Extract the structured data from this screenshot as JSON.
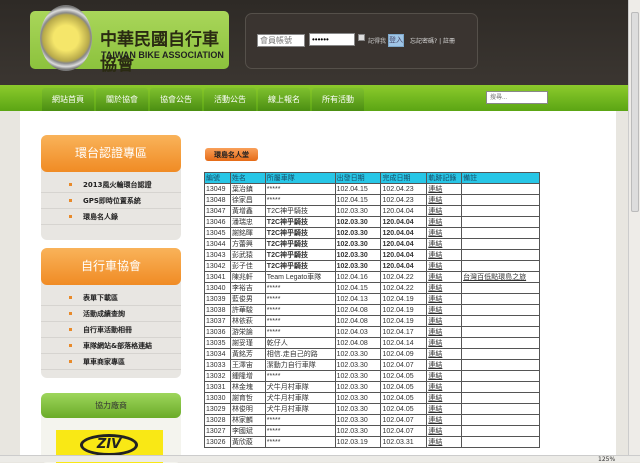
{
  "header": {
    "logo_cn": "中華民國自行車協會",
    "logo_en": "TAIWAN BIKE ASSOCIATION",
    "login": {
      "user_placeholder": "會員帳號",
      "password_value": "••••••",
      "remember_label": "記得我",
      "login_button": "登入",
      "forgot_link": "忘記密碼? | 註冊"
    }
  },
  "nav": {
    "items": [
      "網站首頁",
      "關於協會",
      "協會公告",
      "活動公告",
      "線上報名",
      "所有活動"
    ],
    "search_placeholder": "搜尋..."
  },
  "sidebar": {
    "box1": {
      "title": "環台認證專區",
      "items": [
        "2013風火輪環台認證",
        "GPS即時位置系統",
        "環島名人錄"
      ]
    },
    "box2": {
      "title": "自行車協會",
      "items": [
        "表單下載區",
        "活動成績查詢",
        "自行車活動相冊",
        "車隊網站&部落格連結",
        "單車商家專區"
      ]
    },
    "box3": {
      "title": "協力廠商",
      "sponsor": "ZIV"
    }
  },
  "main": {
    "banner": "環島名人堂",
    "columns": [
      "編號",
      "姓名",
      "所屬車隊",
      "出發日期",
      "完成日期",
      "軌跡記錄",
      "備註"
    ],
    "rows": [
      [
        "13049",
        "葉治鎮",
        "*****",
        "102.04.15",
        "102.04.23",
        "連結",
        ""
      ],
      [
        "13048",
        "徐家昌",
        "*****",
        "102.04.15",
        "102.04.23",
        "連結",
        ""
      ],
      [
        "13047",
        "黃增鑫",
        "T2C神乎騎技",
        "102.03.30",
        "120.04.04",
        "連結",
        ""
      ],
      [
        "13046",
        "潘瑞忠",
        "T2C神乎騎技",
        "102.03.30",
        "120.04.04",
        "連結",
        ""
      ],
      [
        "13045",
        "謝銘暉",
        "T2C神乎騎技",
        "102.03.30",
        "120.04.04",
        "連結",
        ""
      ],
      [
        "13044",
        "方蕾興",
        "T2C神乎騎技",
        "102.03.30",
        "120.04.04",
        "連結",
        ""
      ],
      [
        "13043",
        "彭武猿",
        "T2C神乎騎技",
        "102.03.30",
        "120.04.04",
        "連結",
        ""
      ],
      [
        "13042",
        "彭子佳",
        "T2C神乎騎技",
        "102.03.30",
        "120.04.04",
        "連結",
        ""
      ],
      [
        "13041",
        "陳兆軒",
        "Team Legato車隊",
        "102.04.16",
        "102.04.22",
        "連結",
        "台灣百低點環島之旅"
      ],
      [
        "13040",
        "李裕吉",
        "*****",
        "102.04.15",
        "102.04.22",
        "連結",
        ""
      ],
      [
        "13039",
        "藍俊男",
        "*****",
        "102.04.13",
        "102.04.19",
        "連結",
        ""
      ],
      [
        "13038",
        "許華駿",
        "*****",
        "102.04.08",
        "102.04.19",
        "連結",
        ""
      ],
      [
        "13037",
        "林依萩",
        "*****",
        "102.04.08",
        "102.04.19",
        "連結",
        ""
      ],
      [
        "13036",
        "游栄論",
        "*****",
        "102.04.03",
        "102.04.17",
        "連結",
        ""
      ],
      [
        "13035",
        "謝妥瑾",
        "乾仔人",
        "102.04.08",
        "102.04.14",
        "連結",
        ""
      ],
      [
        "13034",
        "黃銘芳",
        "相信.走自己的路",
        "102.03.30",
        "102.04.09",
        "連結",
        ""
      ],
      [
        "13033",
        "王澤宙",
        "潔動力自行車隊",
        "102.03.30",
        "102.04.07",
        "連結",
        ""
      ],
      [
        "13032",
        "鍾隆增",
        "*****",
        "102.03.30",
        "102.04.05",
        "連結",
        ""
      ],
      [
        "13031",
        "林金塊",
        "犬牛月村車隊",
        "102.03.30",
        "102.04.05",
        "連結",
        ""
      ],
      [
        "13030",
        "謝育哲",
        "犬牛月村車隊",
        "102.03.30",
        "102.04.05",
        "連結",
        ""
      ],
      [
        "13029",
        "林俊明",
        "犬牛月村車隊",
        "102.03.30",
        "102.04.05",
        "連結",
        ""
      ],
      [
        "13028",
        "林家麟",
        "*****",
        "102.03.30",
        "102.04.07",
        "連結",
        ""
      ],
      [
        "13027",
        "李國斌",
        "*****",
        "102.03.30",
        "102.04.07",
        "連結",
        ""
      ],
      [
        "13026",
        "黃欣蒑",
        "*****",
        "102.03.19",
        "102.03.31",
        "連結",
        ""
      ]
    ]
  },
  "status": {
    "zoom": "125%"
  }
}
